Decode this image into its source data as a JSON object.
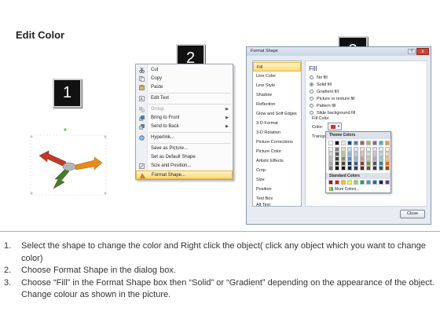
{
  "title": "Edit Color",
  "badges": [
    "1",
    "2",
    "3"
  ],
  "context_menu": {
    "items": [
      {
        "label": "Cut",
        "icon": "scissors-icon",
        "disabled": false
      },
      {
        "label": "Copy",
        "icon": "copy-icon",
        "disabled": false
      },
      {
        "label": "Paste",
        "icon": "paste-icon",
        "disabled": false
      },
      {
        "label": "Edit Text",
        "icon": "edit-text-icon",
        "disabled": false
      },
      {
        "label": "Group",
        "icon": "group-icon",
        "disabled": true,
        "submenu": true
      },
      {
        "label": "Bring to Front",
        "icon": "bring-front-icon",
        "disabled": false,
        "submenu": true
      },
      {
        "label": "Send to Back",
        "icon": "send-back-icon",
        "disabled": false,
        "submenu": true
      },
      {
        "label": "Hyperlink...",
        "icon": "hyperlink-icon",
        "disabled": false
      },
      {
        "label": "Save as Picture...",
        "icon": "",
        "disabled": false
      },
      {
        "label": "Set as Default Shape",
        "icon": "",
        "disabled": false
      },
      {
        "label": "Size and Position...",
        "icon": "size-icon",
        "disabled": false
      },
      {
        "label": "Format Shape...",
        "icon": "format-shape-icon",
        "disabled": false,
        "highlighted": true
      }
    ]
  },
  "dialog": {
    "title": "Format Shape",
    "help": "?",
    "close_x": "x",
    "categories": [
      "Fill",
      "Line Color",
      "Line Style",
      "Shadow",
      "Reflection",
      "Glow and Soft Edges",
      "3-D Format",
      "3-D Rotation",
      "Picture Corrections",
      "Picture Color",
      "Artistic Effects",
      "Crop",
      "Size",
      "Position",
      "Text Box",
      "Alt Text"
    ],
    "selected_category": "Fill",
    "fill_heading": "Fill",
    "options": [
      "No fill",
      "Solid fill",
      "Gradient fill",
      "Picture or texture fill",
      "Pattern fill",
      "Slide background fill"
    ],
    "selected_option": "Solid fill",
    "fill_color_label": "Fill Color",
    "color_label": "Color:",
    "transparency_label": "Transpa",
    "close_button": "Close"
  },
  "palette": {
    "theme_heading": "Theme Colors",
    "standard_heading": "Standard Colors",
    "more_colors": "More Colors...",
    "theme_top": [
      "#ffffff",
      "#000000",
      "#eeece1",
      "#1f497d",
      "#4f81bd",
      "#c0504d",
      "#9bbb59",
      "#8064a2",
      "#4bacc6",
      "#f79646"
    ],
    "theme_shades": [
      [
        "#f2f2f2",
        "#7f7f7f",
        "#ddd9c3",
        "#c6d9f0",
        "#dbe5f1",
        "#f2dcdb",
        "#ebf1dd",
        "#e5e0ec",
        "#dbeef3",
        "#fdeada"
      ],
      [
        "#d8d8d8",
        "#595959",
        "#c4bd97",
        "#8db3e2",
        "#b8cce4",
        "#e5b9b7",
        "#d7e3bc",
        "#ccc1d9",
        "#b7dde8",
        "#fbd5b5"
      ],
      [
        "#bfbfbf",
        "#3f3f3f",
        "#938953",
        "#548dd4",
        "#95b3d7",
        "#d99694",
        "#c3d69b",
        "#b2a2c7",
        "#92cddc",
        "#fac08f"
      ],
      [
        "#a5a5a5",
        "#262626",
        "#494429",
        "#17365d",
        "#366092",
        "#953734",
        "#76923c",
        "#5f497a",
        "#31859b",
        "#e36c09"
      ],
      [
        "#7f7f7f",
        "#0c0c0c",
        "#1d1b10",
        "#0f243e",
        "#244061",
        "#632423",
        "#4f6128",
        "#3f3151",
        "#205867",
        "#974806"
      ]
    ],
    "standard": [
      "#c00000",
      "#ff0000",
      "#ffc000",
      "#ffff00",
      "#92d050",
      "#00b050",
      "#00b0f0",
      "#0070c0",
      "#002060",
      "#7030a0"
    ]
  },
  "figure": {
    "arrow_colors": {
      "red": "#c0392b",
      "orange": "#e8891d",
      "green": "#4a7a2c",
      "hub": "#b5b5b5"
    }
  },
  "steps": [
    {
      "num": "1.",
      "text": "Select the shape to change the color and Right click the object( click any object which you want to change color)"
    },
    {
      "num": "2.",
      "text": "Choose Format Shape in the dialog box."
    },
    {
      "num": "3.",
      "text": "Choose “Fill” in the Format Shape box then “Solid” or “Gradient” depending on the appearance of the object. Change colour as shown in the picture."
    }
  ]
}
